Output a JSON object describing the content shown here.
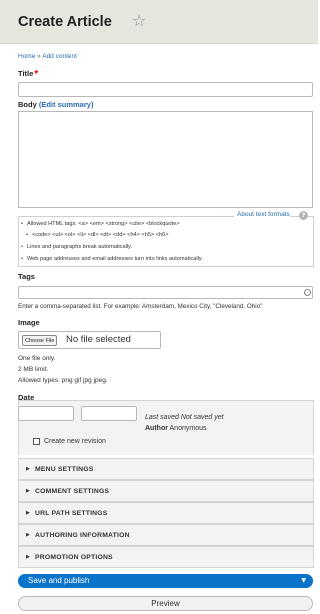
{
  "header": {
    "title": "Create Article",
    "star_icon": "star-outline-icon"
  },
  "breadcrumb": {
    "home": "Home",
    "separator": "»",
    "current": "Add content"
  },
  "title_field": {
    "label": "Title",
    "required_mark": "*",
    "value": ""
  },
  "body_field": {
    "label": "Body",
    "edit_summary": "(Edit summary)",
    "value": "",
    "about_formats": "About text formats",
    "help_icon": "question-mark-icon",
    "tips": [
      "Allowed HTML tags: <a> <em> <strong> <cite> <blockquote>",
      "<code> <ul> <ol> <li> <dl> <dt> <dd> <h4> <h5> <h6>",
      "Lines and paragraphs break automatically.",
      "Web page addresses and email addresses turn into links automatically."
    ]
  },
  "tags_field": {
    "label": "Tags",
    "value": "",
    "help": "Enter a comma-separated list. For example: Amsterdam, Mexico City, \"Cleveland, Ohio\""
  },
  "image_field": {
    "label": "Image",
    "choose_label": "Choose File",
    "status": "No file selected",
    "help": [
      "One file only.",
      "2 MB limit.",
      "Allowed types: png gif jpg jpeg."
    ]
  },
  "date_field": {
    "label": "Date",
    "date_value": "",
    "time_value": ""
  },
  "meta": {
    "last_saved_label": "Last saved",
    "last_saved_value": "Not saved yet",
    "author_label": "Author",
    "author_value": "Anonymous",
    "new_revision_label": "Create new revision",
    "new_revision_checked": false
  },
  "sections": [
    "MENU SETTINGS",
    "COMMENT SETTINGS",
    "URL PATH SETTINGS",
    "AUTHORING INFORMATION",
    "PROMOTION OPTIONS"
  ],
  "actions": {
    "save_label": "Save and publish",
    "preview_label": "Preview"
  },
  "colors": {
    "primary": "#0a74c9",
    "link": "#2a6db0",
    "required": "#ee0000",
    "header_bg": "#e6e6df"
  }
}
